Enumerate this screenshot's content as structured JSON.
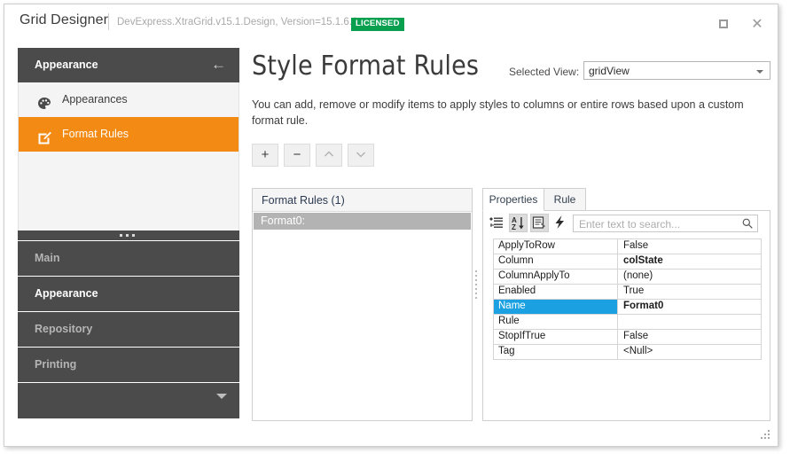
{
  "titlebar": {
    "app_title": "Grid Designer",
    "assembly": "DevExpress.XtraGrid.v15.1.Design, Version=15.1.6.0",
    "license_badge": "LICENSED",
    "maximize_icon": "maximize-icon",
    "close_icon": "close-icon",
    "close_glyph": "✕"
  },
  "sidebar": {
    "header": {
      "title": "Appearance",
      "back_icon": "arrow-left-icon",
      "back_glyph": "←"
    },
    "items": [
      {
        "label": "Appearances",
        "icon": "palette-icon",
        "selected": false
      },
      {
        "label": "Format Rules",
        "icon": "edit-square-icon",
        "selected": true
      }
    ],
    "groups": [
      {
        "label": "Main",
        "active": false
      },
      {
        "label": "Appearance",
        "active": true
      },
      {
        "label": "Repository",
        "active": false
      },
      {
        "label": "Printing",
        "active": false
      }
    ],
    "collapse_icon": "chevron-down-icon",
    "splitter_icon": "splitter-dots-icon"
  },
  "content": {
    "page_title": "Style Format Rules",
    "selected_view_label": "Selected View:",
    "selected_view_value": "gridView",
    "dropdown_icon": "chevron-down-icon",
    "description": "You can add, remove or modify items to apply styles to columns or entire rows based upon a custom format rule.",
    "toolbar": [
      {
        "name": "add-rule-button",
        "glyph": "+",
        "enabled": true
      },
      {
        "name": "remove-rule-button",
        "glyph": "−",
        "enabled": true
      },
      {
        "name": "move-up-button",
        "glyph": "⌃",
        "enabled": false
      },
      {
        "name": "move-down-button",
        "glyph": "⌄",
        "enabled": false
      }
    ]
  },
  "rules_panel": {
    "header": "Format Rules (1)",
    "items": [
      {
        "label": "Format0:",
        "selected": true
      }
    ]
  },
  "properties_panel": {
    "tabs": [
      {
        "label": "Properties",
        "active": true
      },
      {
        "label": "Rule",
        "active": false
      }
    ],
    "toolbar": [
      {
        "name": "categorized-icon",
        "pressed": false
      },
      {
        "name": "alphabetical-sort-icon",
        "pressed": true
      },
      {
        "name": "property-pages-icon",
        "pressed": true
      },
      {
        "name": "events-lightning-icon",
        "pressed": false
      }
    ],
    "search": {
      "placeholder": "Enter text to search...",
      "value": "",
      "icon": "search-icon"
    },
    "grid_rows": [
      {
        "name": "ApplyToRow",
        "value": "False",
        "bold": false,
        "selected": false
      },
      {
        "name": "Column",
        "value": "colState",
        "bold": true,
        "selected": false
      },
      {
        "name": "ColumnApplyTo",
        "value": "(none)",
        "bold": false,
        "selected": false
      },
      {
        "name": "Enabled",
        "value": "True",
        "bold": false,
        "selected": false
      },
      {
        "name": "Name",
        "value": "Format0",
        "bold": true,
        "selected": true
      },
      {
        "name": "Rule",
        "value": "",
        "bold": false,
        "selected": false
      },
      {
        "name": "StopIfTrue",
        "value": "False",
        "bold": false,
        "selected": false
      },
      {
        "name": "Tag",
        "value": "<Null>",
        "bold": false,
        "selected": false
      }
    ]
  },
  "resize_grip_icon": "resize-grip-icon",
  "colors": {
    "accent_orange": "#f28a13",
    "nav_dark": "#4b4b4b",
    "selection_blue": "#1ba1e2",
    "license_green": "#08a04f",
    "list_selection_gray": "#b3b3b3"
  }
}
